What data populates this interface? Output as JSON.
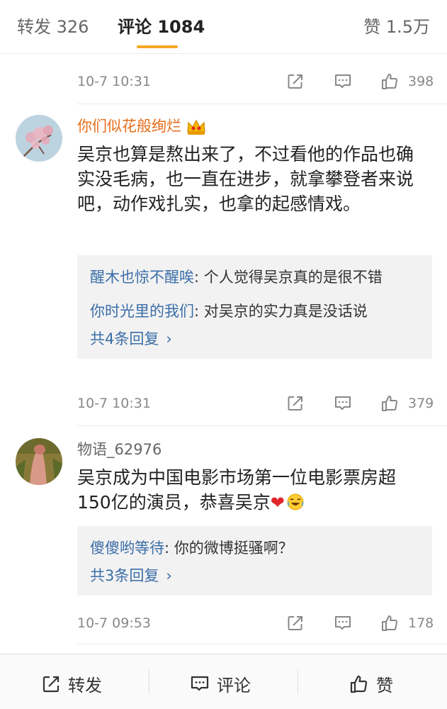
{
  "tabs": {
    "repost": "转发 326",
    "comment": "评论 1084",
    "like": "赞 1.5万",
    "underline_color": "#f6a623"
  },
  "comments": [
    {
      "time": "10-7 10:31",
      "likes": "398"
    },
    {
      "avatar_icon": "cherry-blossom-avatar",
      "username": "你们似花般绚烂",
      "badge_icon": "crown-icon",
      "text": "吴京也算是熬出来了，不过看他的作品也确实没毛病，也一直在进步，就拿攀登者来说吧，动作戏扎实，也拿的起感情戏。",
      "replies": [
        {
          "user": "醒木也惊不醒唉",
          "text": ": 个人觉得吴京真的是很不错"
        },
        {
          "user": "你时光里的我们",
          "text": ": 对吴京的实力真是没话说"
        }
      ],
      "more_replies": "共4条回复",
      "time": "10-7 10:31",
      "likes": "379"
    },
    {
      "avatar_icon": "photo-avatar",
      "username": "物语_62976",
      "text": "吴京成为中国电影市场第一位电影票房超150亿的演员，恭喜吴京",
      "emoji": [
        "heart-icon",
        "laughing-tears-icon"
      ],
      "replies": [
        {
          "user": "傻傻哟等待",
          "text": ": 你的微博挺骚啊？"
        }
      ],
      "more_replies": "共3条回复",
      "time": "10-7 09:53",
      "likes": "178"
    }
  ],
  "bottom_bar": {
    "repost": "转发",
    "comment": "评论",
    "like": "赞"
  },
  "chevron": "›"
}
